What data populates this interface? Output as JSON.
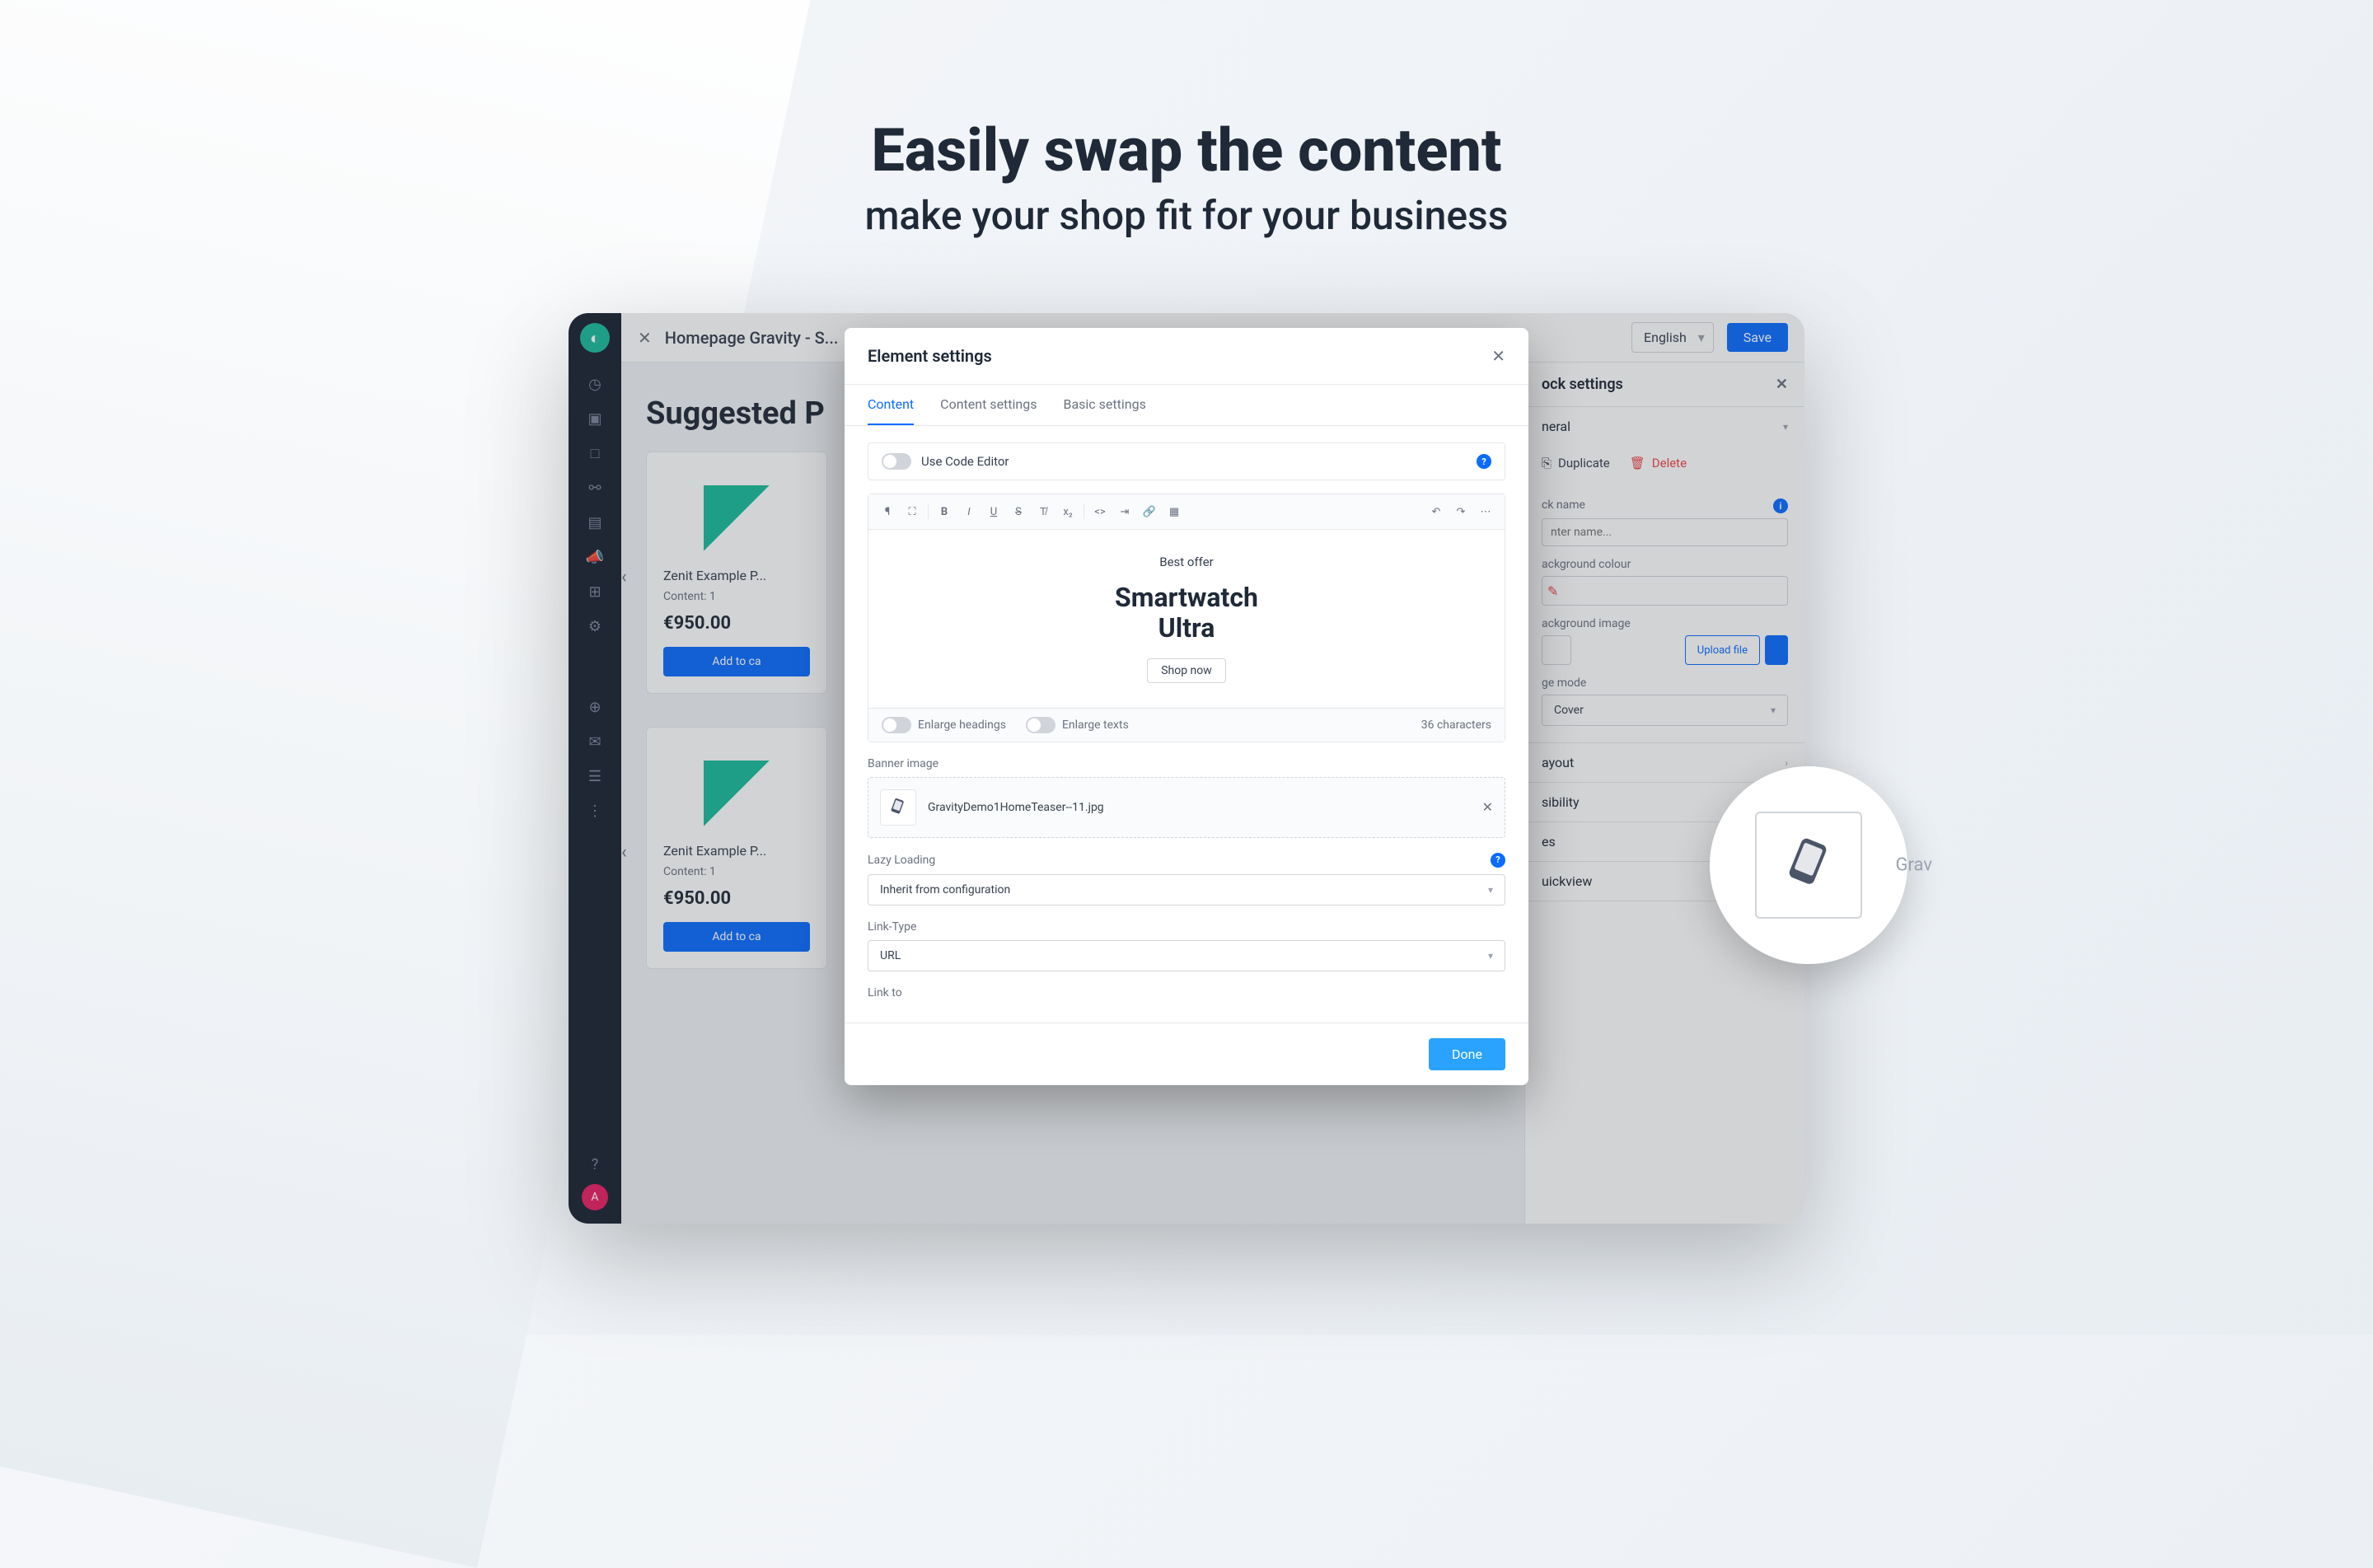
{
  "marketing": {
    "headline": "Easily swap the content",
    "subhead": "make your shop fit for your business"
  },
  "topbar": {
    "title": "Homepage Gravity - S...",
    "language": "English",
    "save": "Save"
  },
  "canvas": {
    "section_title": "Suggested P",
    "product": {
      "name": "Zenit Example P...",
      "meta": "Content: 1",
      "price": "€950.00",
      "add_btn": "Add to ca"
    }
  },
  "block_settings": {
    "title": "ock settings",
    "general": "neral",
    "duplicate": "Duplicate",
    "delete": "Delete",
    "block_name_label": "ck name",
    "block_name_placeholder": "nter name...",
    "bg_color_label": "ackground colour",
    "bg_image_label": "ackground image",
    "upload_btn": "Upload file",
    "image_mode_label": "ge mode",
    "image_mode_value": "Cover",
    "sections": {
      "layout": "ayout",
      "visibility": "sibility",
      "devices": "es",
      "quickview": "uickview"
    }
  },
  "modal": {
    "title": "Element settings",
    "tabs": [
      "Content",
      "Content settings",
      "Basic settings"
    ],
    "code_editor_toggle": "Use Code Editor",
    "editor": {
      "eyebrow": "Best offer",
      "title_line1": "Smartwatch",
      "title_line2": "Ultra",
      "cta": "Shop now",
      "enlarge_headings": "Enlarge headings",
      "enlarge_texts": "Enlarge texts",
      "char_count": "36 characters"
    },
    "banner_image_label": "Banner image",
    "banner_image_name": "GravityDemo1HomeTeaser--11.jpg",
    "lazy_loading_label": "Lazy Loading",
    "lazy_loading_value": "Inherit from configuration",
    "link_type_label": "Link-Type",
    "link_type_value": "URL",
    "link_to_label": "Link to",
    "done_btn": "Done"
  },
  "callout": {
    "label": "Grav"
  },
  "avatar_letter": "A"
}
